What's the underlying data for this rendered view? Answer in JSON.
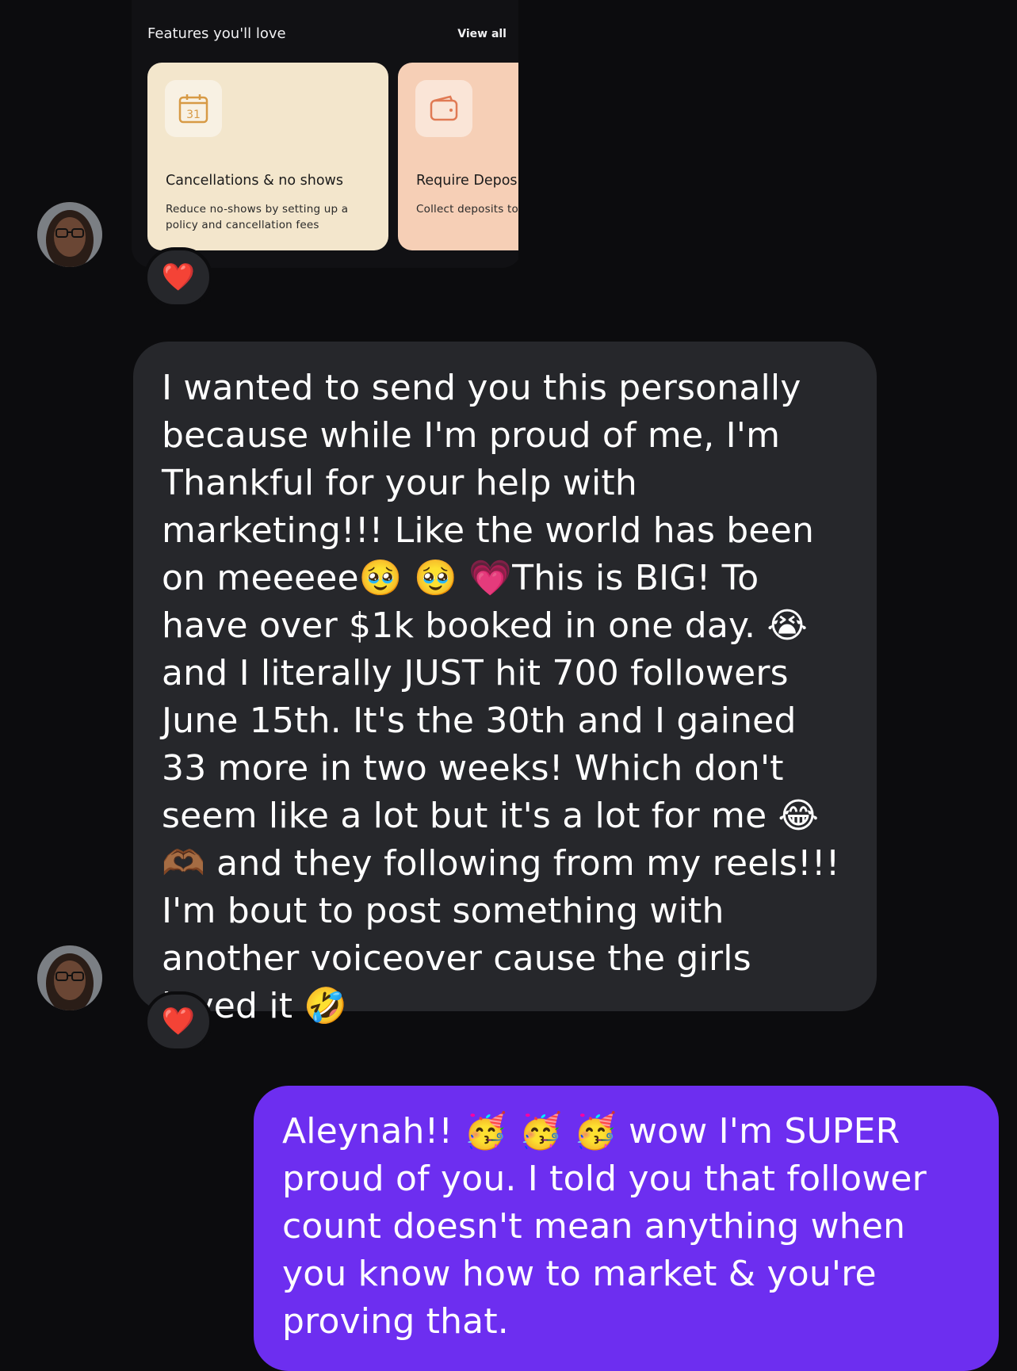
{
  "shared_card": {
    "title": "Features you'll love",
    "view_all": "View all",
    "features": [
      {
        "icon": "calendar-icon",
        "icon_text": "31",
        "title": "Cancellations & no shows",
        "description": "Reduce no-shows by setting up a policy and cancellation fees",
        "bg": "#f3e6cc"
      },
      {
        "icon": "wallet-icon",
        "title": "Require Deposits",
        "description": "Collect deposits to re & no-shows",
        "bg": "#f6cfb6"
      }
    ]
  },
  "messages": [
    {
      "direction": "incoming",
      "reaction": "❤️",
      "text": "I wanted to send you this personally because while I'm proud of me, I'm Thankful for your help with marketing!!! Like the world has been on meeeee🥹 🥹 💗This is BIG! To have over $1k booked in one day. 😭 and I literally JUST hit 700 followers June 15th. It's the 30th and I gained 33 more in two weeks! Which don't seem like a lot but it's a lot for me 😂 🫶🏾 and they following from my reels!!! I'm bout to post something with another voiceover cause the girls loved it 🤣"
    },
    {
      "direction": "outgoing",
      "text": "Aleynah!! 🥳 🥳 🥳 wow I'm SUPER proud of you. I told you that follower count doesn't mean anything when you know how to market & you're proving that."
    }
  ],
  "colors": {
    "background": "#0c0c0e",
    "incoming_bubble": "#26272b",
    "outgoing_bubble": "#6d2ef0"
  }
}
